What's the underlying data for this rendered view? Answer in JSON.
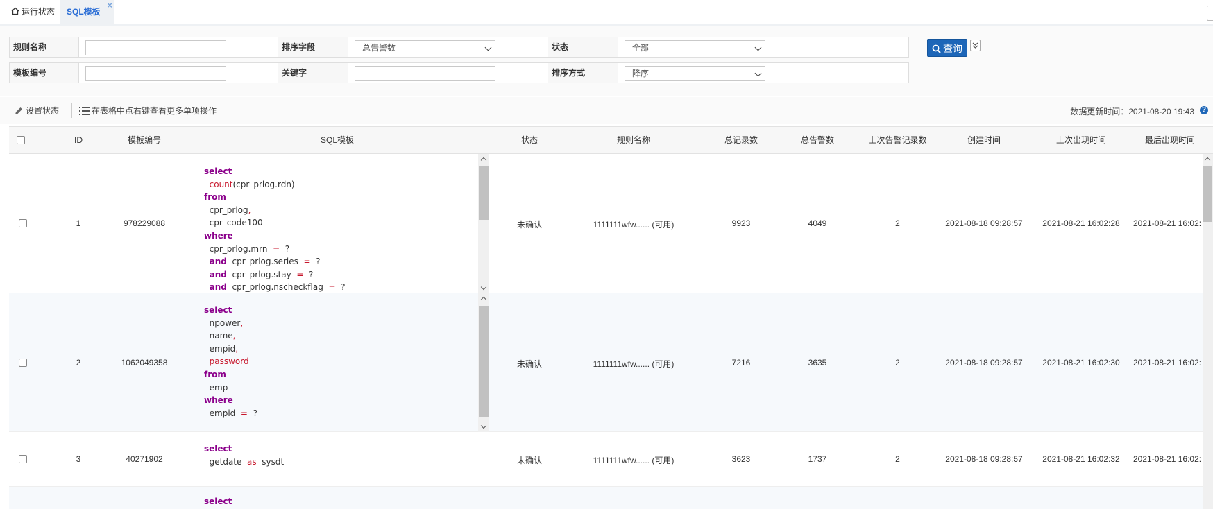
{
  "tabs": [
    {
      "label": "运行状态",
      "icon": "home-icon"
    },
    {
      "label": "SQL模板",
      "close": "×"
    }
  ],
  "filters": {
    "rule_name_label": "规则名称",
    "rule_name_value": "",
    "sort_field_label": "排序字段",
    "sort_field_value": "总告警数",
    "status_label": "状态",
    "status_value": "全部",
    "template_no_label": "模板编号",
    "template_no_value": "",
    "keyword_label": "关键字",
    "keyword_value": "",
    "sort_order_label": "排序方式",
    "sort_order_value": "降序",
    "query_label": "查询"
  },
  "toolbar": {
    "set_status_label": "设置状态",
    "context_hint": "在表格中点右键查看更多单项操作",
    "updated_text": "数据更新时间：2021-08-20 19:43",
    "help": "?"
  },
  "table": {
    "headers": [
      "ID",
      "模板编号",
      "SQL模板",
      "状态",
      "规则名称",
      "总记录数",
      "总告警数",
      "上次告警记录数",
      "创建时间",
      "上次出现时间",
      "最后出现时间"
    ],
    "rows": [
      {
        "id": "1",
        "template_no": "978229088",
        "status": "未确认",
        "rule": "1111111wfw...... (可用)",
        "total_records": "9923",
        "total_alerts": "4049",
        "last_alert_records": "2",
        "created": "2021-08-18 09:28:57",
        "last_seen": "2021-08-21 16:02:28",
        "final_seen": "2021-08-21 16:02:",
        "sql": [
          [
            [
              "kw",
              "select"
            ]
          ],
          [
            [
              "t",
              "  "
            ],
            [
              "fn",
              "count"
            ],
            [
              "t",
              "(cpr_prlog.rdn)"
            ]
          ],
          [
            [
              "kw",
              "from"
            ]
          ],
          [
            [
              "t",
              "  cpr_prlog"
            ],
            [
              "op",
              ","
            ]
          ],
          [
            [
              "t",
              "  cpr_code100"
            ]
          ],
          [
            [
              "kw",
              "where"
            ]
          ],
          [
            [
              "t",
              "  cpr_prlog.mrn  "
            ],
            [
              "op",
              "="
            ],
            [
              "t",
              "  ?"
            ]
          ],
          [
            [
              "t",
              "  "
            ],
            [
              "kw",
              "and"
            ],
            [
              "t",
              "  cpr_prlog.series  "
            ],
            [
              "op",
              "="
            ],
            [
              "t",
              "  ?"
            ]
          ],
          [
            [
              "t",
              "  "
            ],
            [
              "kw",
              "and"
            ],
            [
              "t",
              "  cpr_prlog.stay  "
            ],
            [
              "op",
              "="
            ],
            [
              "t",
              "  ?"
            ]
          ],
          [
            [
              "t",
              "  "
            ],
            [
              "kw",
              "and"
            ],
            [
              "t",
              "  cpr_prlog.nscheckflag  "
            ],
            [
              "op",
              "="
            ],
            [
              "t",
              "  ?"
            ]
          ]
        ]
      },
      {
        "id": "2",
        "template_no": "1062049358",
        "status": "未确认",
        "rule": "1111111wfw...... (可用)",
        "total_records": "7216",
        "total_alerts": "3635",
        "last_alert_records": "2",
        "created": "2021-08-18 09:28:57",
        "last_seen": "2021-08-21 16:02:30",
        "final_seen": "2021-08-21 16:02:",
        "sql": [
          [
            [
              "kw",
              "select"
            ]
          ],
          [
            [
              "t",
              "  npower"
            ],
            [
              "op",
              ","
            ]
          ],
          [
            [
              "t",
              "  name"
            ],
            [
              "op",
              ","
            ]
          ],
          [
            [
              "t",
              "  empid"
            ],
            [
              "op",
              ","
            ]
          ],
          [
            [
              "t",
              "  "
            ],
            [
              "fn",
              "password"
            ]
          ],
          [
            [
              "kw",
              "from"
            ]
          ],
          [
            [
              "t",
              "  emp"
            ]
          ],
          [
            [
              "kw",
              "where"
            ]
          ],
          [
            [
              "t",
              "  empid  "
            ],
            [
              "op",
              "="
            ],
            [
              "t",
              "  ?"
            ]
          ]
        ]
      },
      {
        "id": "3",
        "template_no": "40271902",
        "status": "未确认",
        "rule": "1111111wfw...... (可用)",
        "total_records": "3623",
        "total_alerts": "1737",
        "last_alert_records": "2",
        "created": "2021-08-18 09:28:57",
        "last_seen": "2021-08-21 16:02:32",
        "final_seen": "2021-08-21 16:02:",
        "sql": [
          [
            [
              "kw",
              "select"
            ]
          ],
          [
            [
              "t",
              "  getdate  "
            ],
            [
              "op",
              "as"
            ],
            [
              "t",
              "  sysdt"
            ]
          ]
        ]
      },
      {
        "id": "",
        "template_no": "",
        "status": "",
        "rule": "",
        "total_records": "",
        "total_alerts": "",
        "last_alert_records": "",
        "created": "",
        "last_seen": "",
        "final_seen": "",
        "sql": [
          [
            [
              "kw",
              "select"
            ]
          ]
        ]
      }
    ]
  }
}
